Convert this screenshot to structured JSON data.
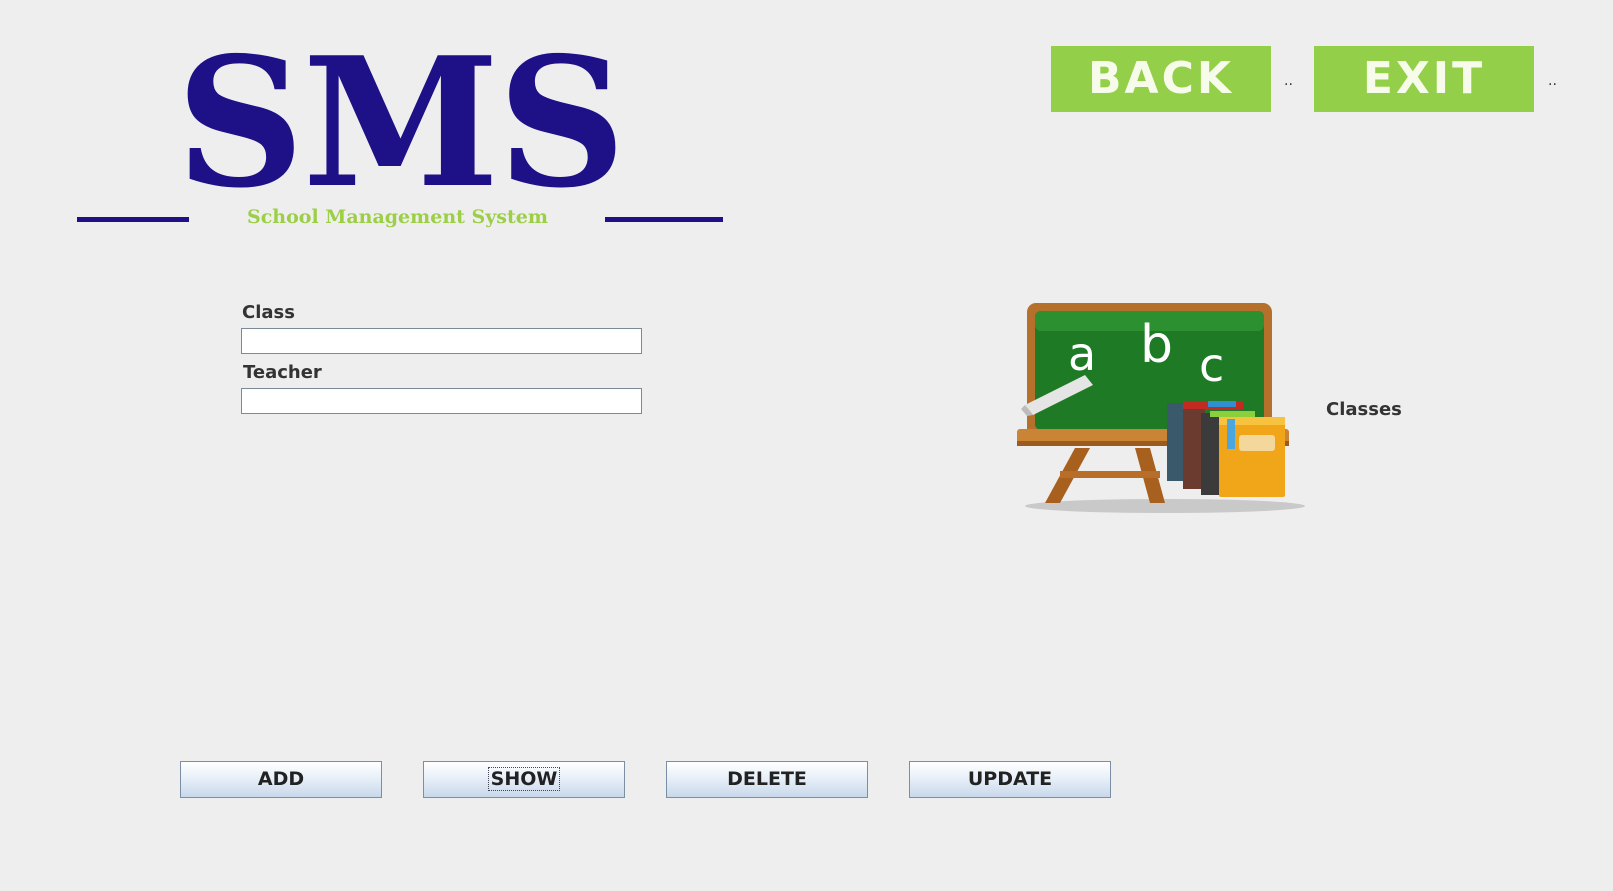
{
  "logo": {
    "title": "SMS",
    "tagline": "School Management System"
  },
  "nav": {
    "back_label": "BACK",
    "exit_label": "EXIT",
    "separator": ".."
  },
  "form": {
    "class_label": "Class",
    "class_value": "",
    "teacher_label": "Teacher",
    "teacher_value": ""
  },
  "illustration": {
    "board_letters": [
      "a",
      "b",
      "c"
    ],
    "caption": "Classes"
  },
  "actions": {
    "add": "ADD",
    "show": "SHOW",
    "delete": "DELETE",
    "update": "UPDATE"
  },
  "colors": {
    "brand_navy": "#1e1087",
    "brand_green": "#9ccf45",
    "button_green": "#93cf48",
    "background": "#eeeeee"
  }
}
